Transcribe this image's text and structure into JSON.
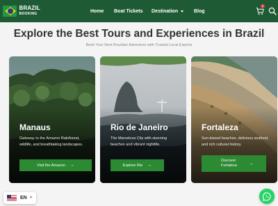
{
  "brand": {
    "line1": "BRAZIL",
    "line2": "BOOKING"
  },
  "nav": {
    "home": "Home",
    "boat_tickets": "Boat Tickets",
    "destination": "Destination",
    "blog": "Blog"
  },
  "cart": {
    "count": "0"
  },
  "hero": {
    "title": "Explore the Best Tours and Experiences in Brazil",
    "subtitle": "Book Your Next Brazilian Adventure with Trusted Local Experts"
  },
  "cards": [
    {
      "title": "Manaus",
      "description": "Gateway to the Amazon Rainforest, wildlife, and breathtaking landscapes.",
      "button": "Visit the Amazon"
    },
    {
      "title": "Rio de Janeiro",
      "description": "The Marvelous City with stunning beaches and vibrant nightlife.",
      "button": "Explore Rio"
    },
    {
      "title": "Fortaleza",
      "description": "Sun-kissed beaches, delicious seafood, and rich cultural history.",
      "button": "Discover Fortaleza"
    }
  ],
  "language": {
    "code": "EN"
  },
  "colors": {
    "header_bg": "#1e5b34",
    "button_bg": "#2b8a32",
    "whatsapp": "#25d366"
  },
  "icons": [
    "cart-icon",
    "search-icon",
    "arrow-right-icon",
    "whatsapp-icon",
    "chevron-down-icon",
    "chevron-up-icon"
  ]
}
